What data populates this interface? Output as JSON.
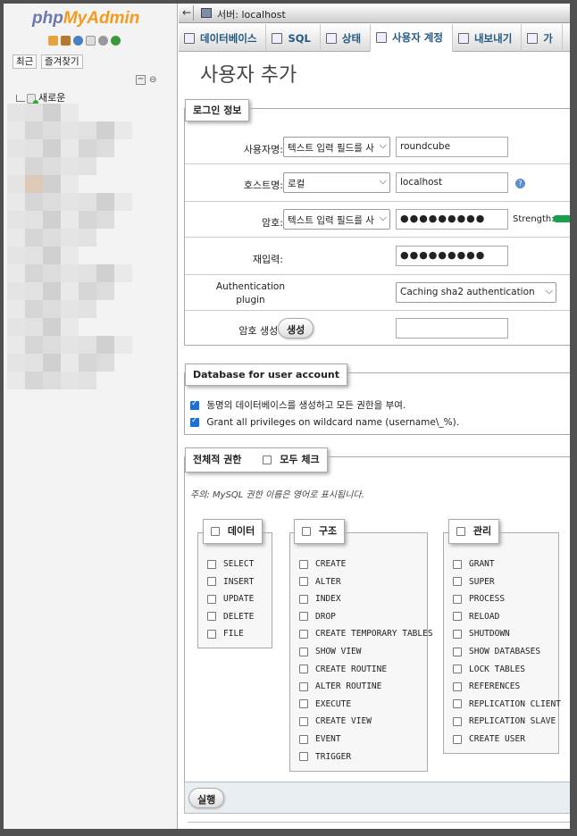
{
  "sidebar": {
    "logo_php": "php",
    "logo_myadmin": "MyAdmin",
    "recent_label": "최근",
    "favorites_label": "즐겨찾기",
    "new_label": "새로운"
  },
  "topbar": {
    "server_label": "서버: localhost"
  },
  "tabs": [
    {
      "label": "데이터베이스"
    },
    {
      "label": "SQL"
    },
    {
      "label": "상태"
    },
    {
      "label": "사용자 계정"
    },
    {
      "label": "내보내기"
    },
    {
      "label": "가"
    }
  ],
  "page_title": "사용자 추가",
  "login": {
    "legend": "로그인 정보",
    "username_label": "사용자명:",
    "username_select": "텍스트 입력 필드를 사",
    "username_value": "roundcube",
    "host_label": "호스트명:",
    "host_select": "로컬",
    "host_value": "localhost",
    "password_label": "암호:",
    "password_select": "텍스트 입력 필드를 사",
    "password_value": "●●●●●●●●●",
    "strength_label": "Strength:",
    "reenter_label": "재입력:",
    "reenter_value": "●●●●●●●●●",
    "auth_label_1": "Authentication",
    "auth_label_2": "plugin",
    "auth_select": "Caching sha2 authentication",
    "generate_label": "암호 생성:",
    "generate_button": "생성"
  },
  "database": {
    "legend": "Database for user account",
    "opt1": "동명의 데이터베이스를 생성하고 모든 권한을 부여.",
    "opt2": "Grant all privileges on wildcard name (username\\_%)."
  },
  "global": {
    "legend": "전체적 권한",
    "check_all": "모두 체크",
    "note": "주의: MySQL 권한 이름은 영어로 표시됩니다."
  },
  "privileges": {
    "data": {
      "title": "데이터",
      "items": [
        "SELECT",
        "INSERT",
        "UPDATE",
        "DELETE",
        "FILE"
      ]
    },
    "structure": {
      "title": "구조",
      "items": [
        "CREATE",
        "ALTER",
        "INDEX",
        "DROP",
        "CREATE TEMPORARY TABLES",
        "SHOW VIEW",
        "CREATE ROUTINE",
        "ALTER ROUTINE",
        "EXECUTE",
        "CREATE VIEW",
        "EVENT",
        "TRIGGER"
      ]
    },
    "admin": {
      "title": "관리",
      "items": [
        "GRANT",
        "SUPER",
        "PROCESS",
        "RELOAD",
        "SHUTDOWN",
        "SHOW DATABASES",
        "LOCK TABLES",
        "REFERENCES",
        "REPLICATION CLIENT",
        "REPLICATION SLAVE",
        "CREATE USER"
      ]
    }
  },
  "execute_button": "실행",
  "colors": {
    "accent": "#235a81",
    "strength_bar": "#19a04b",
    "checkbox": "#1a6fd8"
  }
}
